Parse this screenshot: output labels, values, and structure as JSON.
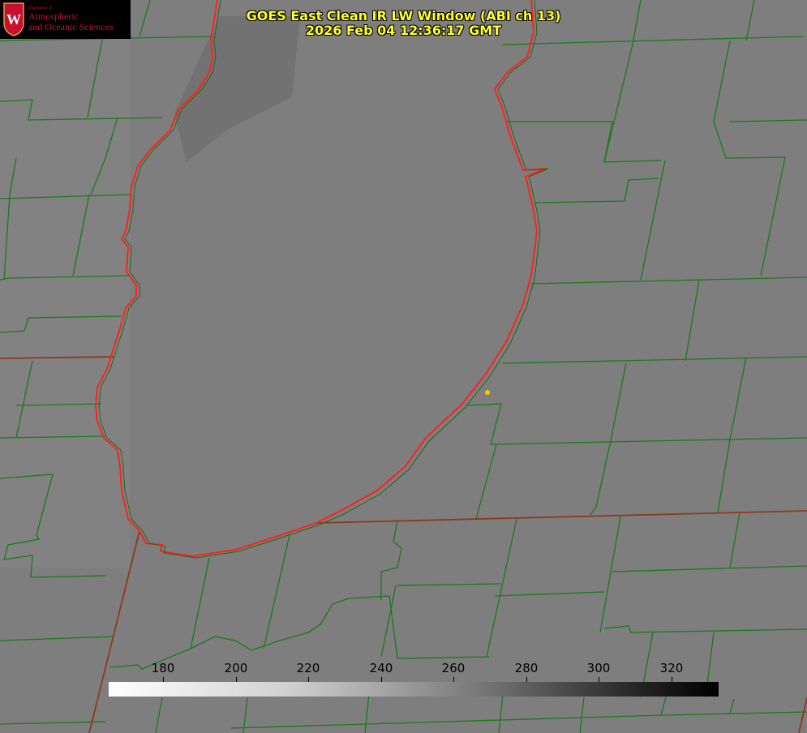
{
  "header": {
    "title_line1": "GOES East Clean IR LW Window (ABI ch 13)",
    "title_line2": "2026 Feb 04 12:36:17 GMT"
  },
  "logo": {
    "department": "Department of",
    "line1": "Atmospheric",
    "line2": "and Oceanic Sciences",
    "crest_letter": "W",
    "crest_icon": "uw-crest-icon"
  },
  "colorbar": {
    "ticks": [
      "180",
      "200",
      "220",
      "240",
      "260",
      "280",
      "300",
      "320"
    ],
    "tick_values": [
      180,
      200,
      220,
      240,
      260,
      280,
      300,
      320
    ],
    "range": [
      165,
      333
    ],
    "scale": "white-to-black grayscale"
  },
  "colors": {
    "title": "#ffff33",
    "county_lines": "#1a7a1a",
    "state_lines": "#8b3a1a",
    "lake_outline": "#ff2020",
    "station_marker": "#e8d000",
    "background": "#808080"
  }
}
